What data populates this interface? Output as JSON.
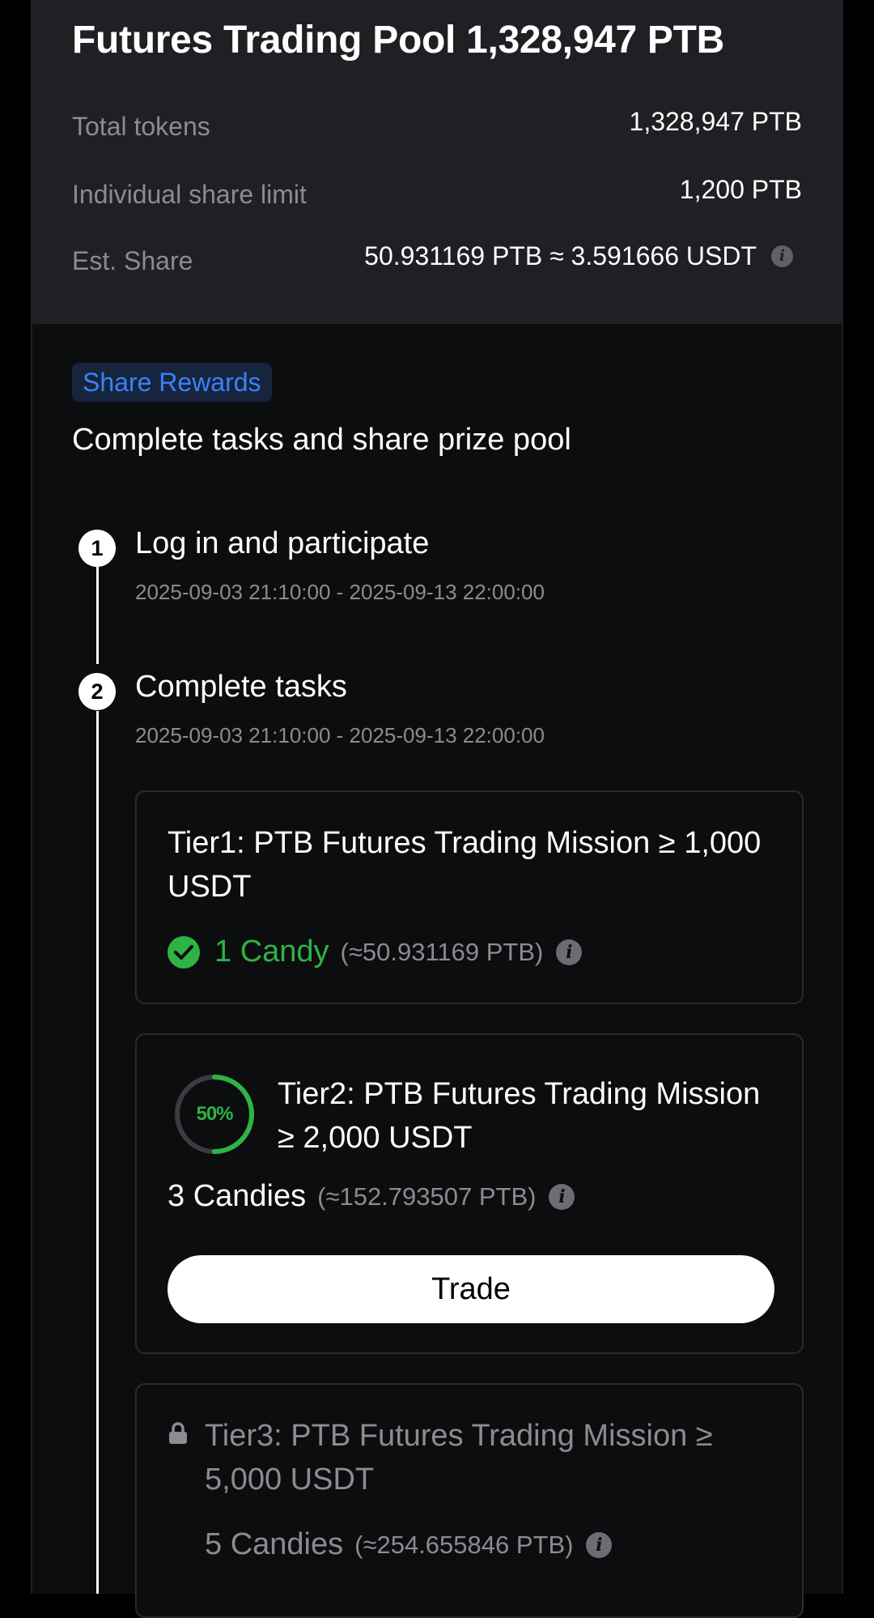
{
  "pool": {
    "title": "Futures Trading Pool 1,328,947 PTB",
    "rows": [
      {
        "label": "Total tokens",
        "value": "1,328,947 PTB"
      },
      {
        "label": "Individual share limit",
        "value": "1,200 PTB"
      },
      {
        "label": "Est. Share",
        "value": "50.931169 PTB ≈ 3.591666 USDT"
      }
    ]
  },
  "rewards": {
    "badge": "Share Rewards",
    "subtitle": "Complete tasks and share prize pool"
  },
  "steps": [
    {
      "number": "1",
      "title": "Log in and participate",
      "date": "2025-09-03 21:10:00 - 2025-09-13 22:00:00"
    },
    {
      "number": "2",
      "title": "Complete tasks",
      "date": "2025-09-03 21:10:00 - 2025-09-13 22:00:00"
    }
  ],
  "tiers": [
    {
      "title": "Tier1: PTB Futures Trading Mission ≥ 1,000 USDT",
      "reward": "1 Candy",
      "reward_ptb": "(≈50.931169 PTB)",
      "status": "completed"
    },
    {
      "title": "Tier2: PTB Futures Trading Mission ≥ 2,000 USDT",
      "progress_label": "50%",
      "progress": 0.5,
      "reward": "3 Candies",
      "reward_ptb": "(≈152.793507 PTB)",
      "button": "Trade",
      "status": "in-progress"
    },
    {
      "title": "Tier3: PTB Futures Trading Mission ≥ 5,000 USDT",
      "reward": "5 Candies",
      "reward_ptb": "(≈254.655846 PTB)",
      "status": "locked"
    }
  ],
  "colors": {
    "accent_blue": "#3a82f7",
    "success_green": "#2fb344",
    "header_bg": "#1f2023",
    "page_bg": "#0c0d0f"
  },
  "icons": [
    "info-icon",
    "check-circle-icon",
    "progress-ring-icon",
    "lock-icon"
  ]
}
